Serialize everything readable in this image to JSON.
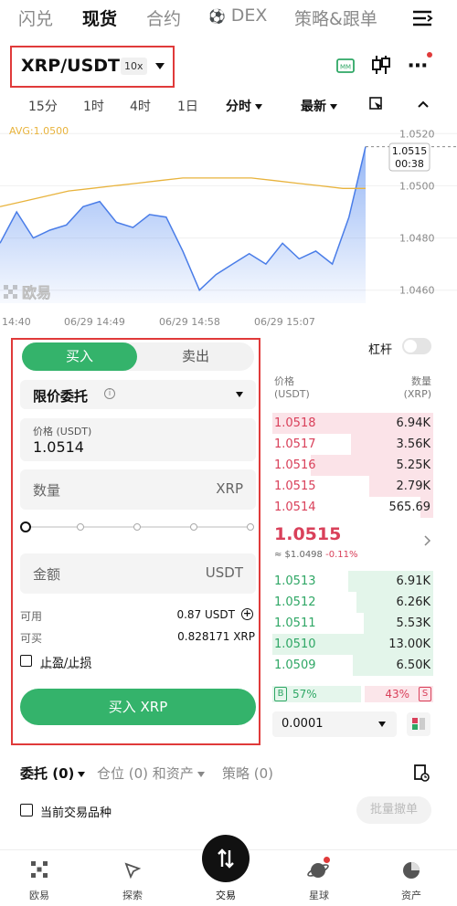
{
  "top_tabs": [
    {
      "label": "闪兑",
      "active": false
    },
    {
      "label": "现货",
      "active": true
    },
    {
      "label": "合约",
      "active": false
    },
    {
      "label": "DEX",
      "active": false
    },
    {
      "label": "策略&跟单",
      "active": false
    }
  ],
  "pair": {
    "name": "XRP/USDT",
    "leverage": "10x"
  },
  "timeframes": [
    "15分",
    "1时",
    "4时",
    "1日",
    "分时",
    "最新"
  ],
  "chart_data": {
    "type": "area",
    "avg_label": "AVG:1.0500",
    "avg_values": [
      1.0492,
      1.0494,
      1.0496,
      1.0498,
      1.0499,
      1.05,
      1.0501,
      1.0502,
      1.0503,
      1.0503,
      1.0503,
      1.0503,
      1.0502,
      1.0501,
      1.05,
      1.0499,
      1.0499
    ],
    "price_values": [
      1.0478,
      1.049,
      1.048,
      1.0483,
      1.0485,
      1.0492,
      1.0494,
      1.0486,
      1.0484,
      1.0489,
      1.0488,
      1.0475,
      1.046,
      1.0466,
      1.047,
      1.0474,
      1.047,
      1.0478,
      1.0472,
      1.0475,
      1.047,
      1.0488,
      1.0515
    ],
    "last_price": "1.0515",
    "countdown": "00:38",
    "y_ticks": [
      "1.0520",
      "1.0500",
      "1.0480",
      "1.0460"
    ],
    "x_ticks": [
      "14:40",
      "06/29 14:49",
      "06/29 14:58",
      "06/29 15:07"
    ],
    "ylim": [
      1.0455,
      1.0525
    ],
    "watermark": "欧易"
  },
  "form": {
    "buy_tab": "买入",
    "sell_tab": "卖出",
    "order_type": "限价委托",
    "price_label": "价格 (USDT)",
    "price_value": "1.0514",
    "qty_label": "数量",
    "qty_unit": "XRP",
    "amount_label": "金额",
    "amount_unit": "USDT",
    "available_label": "可用",
    "available_value": "0.87 USDT",
    "buyable_label": "可买",
    "buyable_value": "0.828171 XRP",
    "tpsl_label": "止盈/止损",
    "submit_label": "买入 XRP"
  },
  "orderbook": {
    "leverage_label": "杠杆",
    "price_header": "价格",
    "price_unit": "(USDT)",
    "qty_header": "数量",
    "qty_unit": "(XRP)",
    "asks": [
      {
        "price": "1.0518",
        "qty": "6.94K",
        "depth": 1.0
      },
      {
        "price": "1.0517",
        "qty": "3.56K",
        "depth": 0.51
      },
      {
        "price": "1.0516",
        "qty": "5.25K",
        "depth": 0.76
      },
      {
        "price": "1.0515",
        "qty": "2.79K",
        "depth": 0.4
      },
      {
        "price": "1.0514",
        "qty": "565.69",
        "depth": 0.08
      }
    ],
    "mid_price": "1.0515",
    "mid_usd": "≈ $1.0498",
    "mid_change": "-0.11%",
    "bids": [
      {
        "price": "1.0513",
        "qty": "6.91K",
        "depth": 0.53
      },
      {
        "price": "1.0512",
        "qty": "6.26K",
        "depth": 0.48
      },
      {
        "price": "1.0511",
        "qty": "5.53K",
        "depth": 0.43
      },
      {
        "price": "1.0510",
        "qty": "13.00K",
        "depth": 1.0
      },
      {
        "price": "1.0509",
        "qty": "6.50K",
        "depth": 0.5
      }
    ],
    "buy_ratio": "57%",
    "sell_ratio": "43%",
    "buy_badge": "B",
    "sell_badge": "S",
    "precision": "0.0001"
  },
  "bottom_tabs": {
    "orders": "委托 (0)",
    "positions": "仓位 (0) 和资产",
    "strategies": "策略 (0)",
    "current_pair": "当前交易品种",
    "cancel_all": "批量撤单"
  },
  "nav": [
    "欧易",
    "探索",
    "交易",
    "星球",
    "资产"
  ],
  "colors": {
    "buy": "#34b36b",
    "sell": "#d9405a",
    "accent_red": "#e03a3a"
  }
}
